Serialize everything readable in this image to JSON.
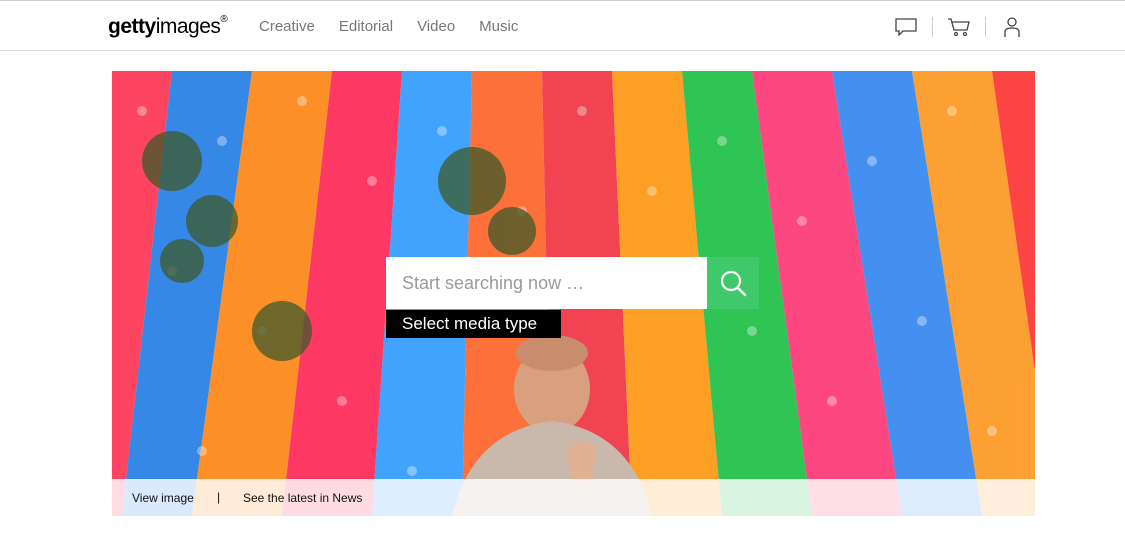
{
  "header": {
    "logo": {
      "brand_bold": "getty",
      "brand_rest": "images",
      "registered": "®"
    },
    "nav": [
      "Creative",
      "Editorial",
      "Video",
      "Music"
    ],
    "icons": [
      "chat-icon",
      "cart-icon",
      "user-icon"
    ]
  },
  "search": {
    "placeholder": "Start searching now …",
    "media_type_label": "Select media type",
    "button_icon": "search-icon"
  },
  "hero_bar": {
    "view_image": "View image",
    "separator": "|",
    "latest_news": "See the latest in News"
  },
  "colors": {
    "accent_green": "#3fc96b",
    "nav_text": "#777777"
  }
}
